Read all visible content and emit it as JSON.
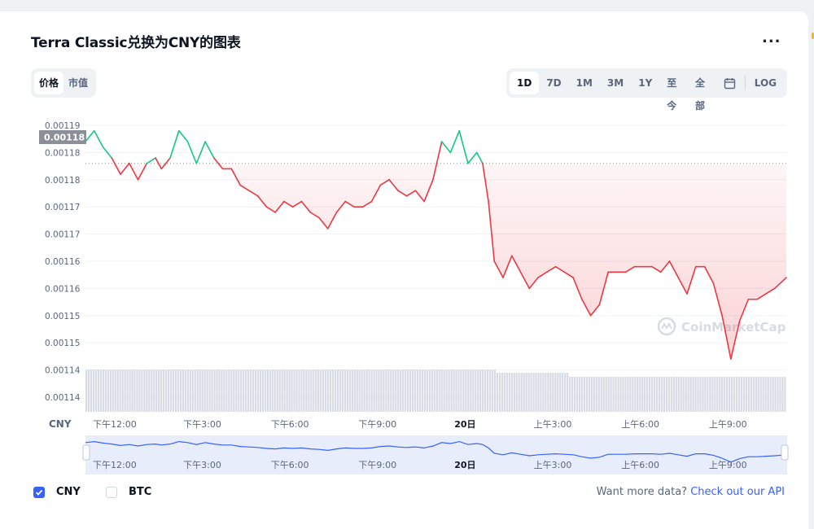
{
  "title": "Terra Classic兑换为CNY的图表",
  "more_label": "...",
  "view_toggle": [
    "价格",
    "市值"
  ],
  "view_selected": 0,
  "ranges": [
    "1D",
    "7D",
    "1M",
    "3M",
    "1Y",
    "至今",
    "全部"
  ],
  "range_selected": 0,
  "log_label": "LOG",
  "calendar_icon": "calendar-icon",
  "currency_axis_label": "CNY",
  "watermark": "CoinMarketCap",
  "current_price_label": "0.00118",
  "legend": [
    {
      "label": "CNY",
      "checked": true
    },
    {
      "label": "BTC",
      "checked": false
    }
  ],
  "api_text": "Want more data?",
  "api_link": "Check out our API",
  "colors": {
    "up": "#16c784",
    "down": "#ea3943",
    "accent": "#3861fb",
    "volume": "#d7dbe3",
    "navigator": "#e8edfc"
  },
  "chart_data": {
    "type": "line",
    "x_tick_labels": [
      "下午12:00",
      "下午3:00",
      "下午6:00",
      "下午9:00",
      "20日",
      "上午3:00",
      "上午6:00",
      "上午9:00"
    ],
    "y_tick_labels": [
      "0.00119",
      "0.00118",
      "0.00118",
      "0.00117",
      "0.00117",
      "0.00116",
      "0.00116",
      "0.00115",
      "0.00115",
      "0.00114",
      "0.00114"
    ],
    "ylim": [
      0.00114,
      0.00119
    ],
    "baseline": 0.001183,
    "x_range_hours": [
      11,
      35
    ],
    "series": [
      {
        "values": [
          [
            11.0,
            0.001187
          ],
          [
            11.3,
            0.001189
          ],
          [
            11.6,
            0.001186
          ],
          [
            11.9,
            0.001184
          ],
          [
            12.2,
            0.001181
          ],
          [
            12.5,
            0.001183
          ],
          [
            12.8,
            0.00118
          ],
          [
            13.1,
            0.001183
          ],
          [
            13.4,
            0.001184
          ],
          [
            13.6,
            0.001182
          ],
          [
            13.9,
            0.001184
          ],
          [
            14.2,
            0.001189
          ],
          [
            14.5,
            0.001187
          ],
          [
            14.8,
            0.001183
          ],
          [
            15.1,
            0.001187
          ],
          [
            15.4,
            0.001184
          ],
          [
            15.7,
            0.001182
          ],
          [
            16.0,
            0.001182
          ],
          [
            16.3,
            0.001179
          ],
          [
            16.6,
            0.001178
          ],
          [
            16.9,
            0.001177
          ],
          [
            17.2,
            0.001175
          ],
          [
            17.5,
            0.001174
          ],
          [
            17.8,
            0.001176
          ],
          [
            18.1,
            0.001175
          ],
          [
            18.4,
            0.001176
          ],
          [
            18.7,
            0.001174
          ],
          [
            19.0,
            0.001173
          ],
          [
            19.3,
            0.001171
          ],
          [
            19.6,
            0.001174
          ],
          [
            19.9,
            0.001176
          ],
          [
            20.2,
            0.001175
          ],
          [
            20.5,
            0.001175
          ],
          [
            20.8,
            0.001176
          ],
          [
            21.1,
            0.001179
          ],
          [
            21.4,
            0.00118
          ],
          [
            21.7,
            0.001178
          ],
          [
            22.0,
            0.001177
          ],
          [
            22.3,
            0.001178
          ],
          [
            22.6,
            0.001176
          ],
          [
            22.9,
            0.00118
          ],
          [
            23.2,
            0.001187
          ],
          [
            23.5,
            0.001185
          ],
          [
            23.8,
            0.001189
          ],
          [
            24.1,
            0.001183
          ],
          [
            24.4,
            0.001185
          ],
          [
            24.6,
            0.001183
          ],
          [
            24.8,
            0.001176
          ],
          [
            25.0,
            0.001165
          ],
          [
            25.3,
            0.001162
          ],
          [
            25.6,
            0.001166
          ],
          [
            25.9,
            0.001163
          ],
          [
            26.2,
            0.00116
          ],
          [
            26.5,
            0.001162
          ],
          [
            26.8,
            0.001163
          ],
          [
            27.1,
            0.001164
          ],
          [
            27.4,
            0.001163
          ],
          [
            27.7,
            0.001162
          ],
          [
            28.0,
            0.001158
          ],
          [
            28.3,
            0.001155
          ],
          [
            28.6,
            0.001157
          ],
          [
            28.9,
            0.001163
          ],
          [
            29.2,
            0.001163
          ],
          [
            29.5,
            0.001163
          ],
          [
            29.8,
            0.001164
          ],
          [
            30.1,
            0.001164
          ],
          [
            30.4,
            0.001164
          ],
          [
            30.7,
            0.001163
          ],
          [
            31.0,
            0.001165
          ],
          [
            31.3,
            0.001162
          ],
          [
            31.6,
            0.001159
          ],
          [
            31.9,
            0.001164
          ],
          [
            32.2,
            0.001164
          ],
          [
            32.5,
            0.001161
          ],
          [
            32.8,
            0.001155
          ],
          [
            33.1,
            0.001147
          ],
          [
            33.4,
            0.001154
          ],
          [
            33.7,
            0.001158
          ],
          [
            34.0,
            0.001158
          ],
          [
            34.3,
            0.001159
          ],
          [
            34.6,
            0.00116
          ],
          [
            35.0,
            0.001162
          ]
        ]
      }
    ],
    "grid": true
  }
}
